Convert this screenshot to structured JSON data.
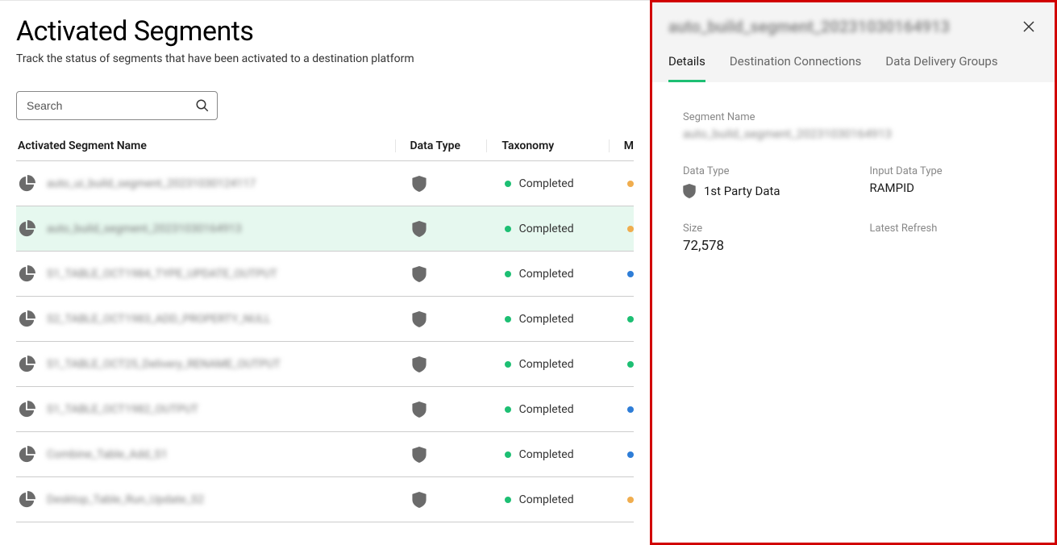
{
  "page": {
    "title": "Activated Segments",
    "subtitle": "Track the status of segments that have been activated to a destination platform"
  },
  "search": {
    "placeholder": "Search"
  },
  "columns": {
    "name": "Activated Segment Name",
    "dataType": "Data Type",
    "taxonomy": "Taxonomy",
    "m": "M"
  },
  "rows": [
    {
      "name": "auto_ui_build_segment_20231030124117",
      "taxonomy": "Completed",
      "selected": false,
      "mdot": "orange"
    },
    {
      "name": "auto_build_segment_20231030164913",
      "taxonomy": "Completed",
      "selected": true,
      "mdot": "orange"
    },
    {
      "name": "S1_TABLE_OCT1984_TYPE_UPDATE_OUTPUT",
      "taxonomy": "Completed",
      "selected": false,
      "mdot": "blue"
    },
    {
      "name": "S2_TABLE_OCT1983_ADD_PROPERTY_NULL",
      "taxonomy": "Completed",
      "selected": false,
      "mdot": "green"
    },
    {
      "name": "S1_TABLE_OCT25_Delivery_RENAME_OUTPUT",
      "taxonomy": "Completed",
      "selected": false,
      "mdot": "green"
    },
    {
      "name": "S1_TABLE_OCT1982_OUTPUT",
      "taxonomy": "Completed",
      "selected": false,
      "mdot": "blue"
    },
    {
      "name": "Combine_Table_Add_S1",
      "taxonomy": "Completed",
      "selected": false,
      "mdot": "blue"
    },
    {
      "name": "Desktop_Table_Run_Update_S2",
      "taxonomy": "Completed",
      "selected": false,
      "mdot": "orange"
    }
  ],
  "panel": {
    "title": "auto_build_segment_20231030164913",
    "tabs": {
      "details": "Details",
      "destinations": "Destination Connections",
      "delivery": "Data Delivery Groups"
    },
    "fields": {
      "segmentNameLabel": "Segment Name",
      "segmentNameValue": "auto_build_segment_20231030164913",
      "dataTypeLabel": "Data Type",
      "dataTypeValue": "1st Party Data",
      "inputDataTypeLabel": "Input Data Type",
      "inputDataTypeValue": "RAMPID",
      "sizeLabel": "Size",
      "sizeValue": "72,578",
      "latestRefreshLabel": "Latest Refresh"
    }
  }
}
